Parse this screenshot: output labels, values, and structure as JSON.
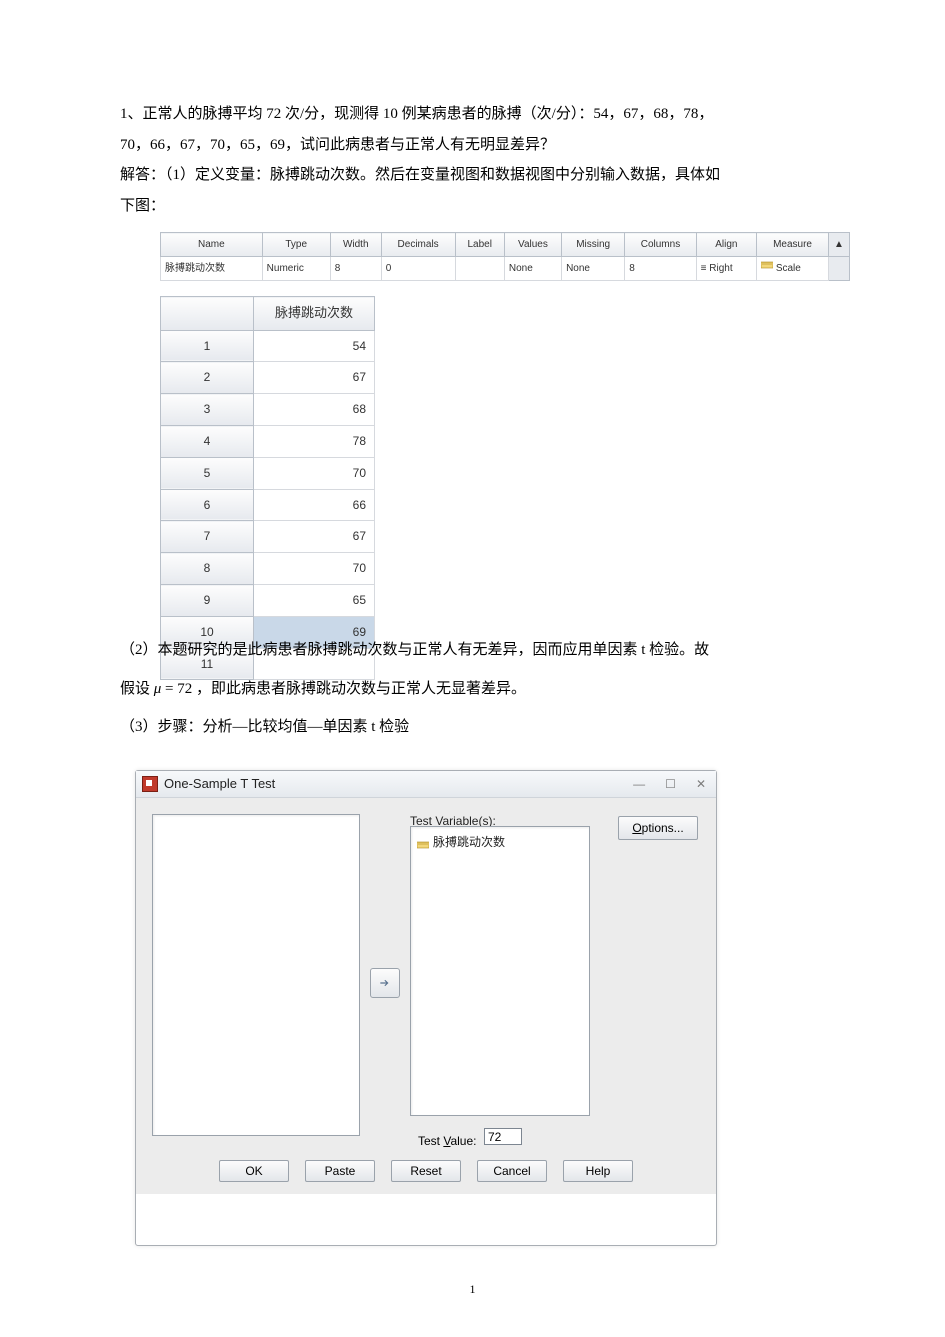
{
  "paragraphs": {
    "p1": "1、正常人的脉搏平均 72 次/分，现测得 10 例某病患者的脉搏（次/分）：54，67，68，78，",
    "p2": "70，66，67，70，65，69，试问此病患者与正常人有无明显差异？",
    "p3": "解答：（1）定义变量：脉搏跳动次数。然后在变量视图和数据视图中分别输入数据，具体如",
    "p4": "下图：",
    "p5": "（2）本题研究的是此病患者脉搏跳动次数与正常人有无差异，因而应用单因素 t 检验。故",
    "p6_pre": "假设 ",
    "p6_mu": "μ",
    "p6_eq": " = 72 ",
    "p6_post": "，即此病患者脉搏跳动次数与正常人无显著差异。",
    "p7": "（3）步骤：分析—比较均值—单因素 t 检验"
  },
  "variable_view": {
    "headers": [
      "Name",
      "Type",
      "Width",
      "Decimals",
      "Label",
      "Values",
      "Missing",
      "Columns",
      "Align",
      "Measure"
    ],
    "row": {
      "name": "脉搏跳动次数",
      "type": "Numeric",
      "width": "8",
      "decimals": "0",
      "label": "",
      "values": "None",
      "missing": "None",
      "columns": "8",
      "align": "≡ Right",
      "measure": "Scale"
    }
  },
  "data_view": {
    "column_header": "脉搏跳动次数",
    "rows": [
      {
        "idx": "1",
        "val": "54"
      },
      {
        "idx": "2",
        "val": "67"
      },
      {
        "idx": "3",
        "val": "68"
      },
      {
        "idx": "4",
        "val": "78"
      },
      {
        "idx": "5",
        "val": "70"
      },
      {
        "idx": "6",
        "val": "66"
      },
      {
        "idx": "7",
        "val": "67"
      },
      {
        "idx": "8",
        "val": "70"
      },
      {
        "idx": "9",
        "val": "65"
      },
      {
        "idx": "10",
        "val": "69"
      }
    ],
    "empty_row_idx": "11"
  },
  "dialog": {
    "title": "One-Sample T Test",
    "test_variables_label": "Test Variable(s):",
    "test_variables_label_prefix": "T",
    "test_variable_item": "脉搏跳动次数",
    "options_label": "Options...",
    "options_underline": "O",
    "test_value_label": "Test Value:",
    "test_value_underline": "V",
    "test_value": "72",
    "buttons": {
      "ok": "OK",
      "paste": "Paste",
      "reset": "Reset",
      "cancel": "Cancel",
      "help": "Help"
    },
    "close_glyph": "✕"
  },
  "page_number": "1",
  "measure_icon_color": "#c79a2a"
}
